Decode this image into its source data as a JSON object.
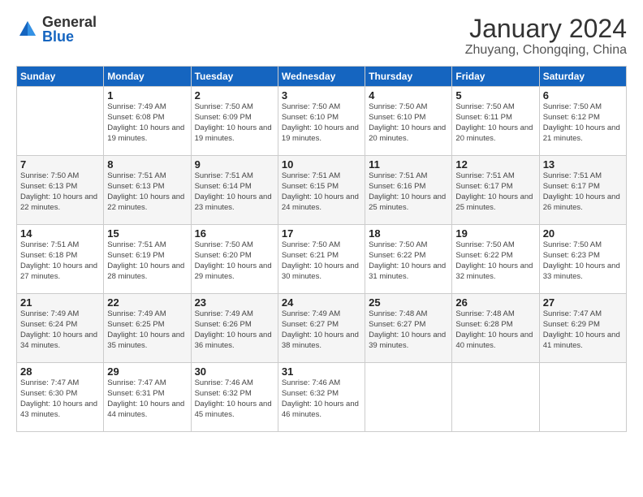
{
  "logo": {
    "general": "General",
    "blue": "Blue"
  },
  "title": "January 2024",
  "subtitle": "Zhuyang, Chongqing, China",
  "days_of_week": [
    "Sunday",
    "Monday",
    "Tuesday",
    "Wednesday",
    "Thursday",
    "Friday",
    "Saturday"
  ],
  "weeks": [
    [
      {
        "date": "",
        "info": ""
      },
      {
        "date": "1",
        "info": "Sunrise: 7:49 AM\nSunset: 6:08 PM\nDaylight: 10 hours\nand 19 minutes."
      },
      {
        "date": "2",
        "info": "Sunrise: 7:50 AM\nSunset: 6:09 PM\nDaylight: 10 hours\nand 19 minutes."
      },
      {
        "date": "3",
        "info": "Sunrise: 7:50 AM\nSunset: 6:10 PM\nDaylight: 10 hours\nand 19 minutes."
      },
      {
        "date": "4",
        "info": "Sunrise: 7:50 AM\nSunset: 6:10 PM\nDaylight: 10 hours\nand 20 minutes."
      },
      {
        "date": "5",
        "info": "Sunrise: 7:50 AM\nSunset: 6:11 PM\nDaylight: 10 hours\nand 20 minutes."
      },
      {
        "date": "6",
        "info": "Sunrise: 7:50 AM\nSunset: 6:12 PM\nDaylight: 10 hours\nand 21 minutes."
      }
    ],
    [
      {
        "date": "7",
        "info": "Sunrise: 7:50 AM\nSunset: 6:13 PM\nDaylight: 10 hours\nand 22 minutes."
      },
      {
        "date": "8",
        "info": "Sunrise: 7:51 AM\nSunset: 6:13 PM\nDaylight: 10 hours\nand 22 minutes."
      },
      {
        "date": "9",
        "info": "Sunrise: 7:51 AM\nSunset: 6:14 PM\nDaylight: 10 hours\nand 23 minutes."
      },
      {
        "date": "10",
        "info": "Sunrise: 7:51 AM\nSunset: 6:15 PM\nDaylight: 10 hours\nand 24 minutes."
      },
      {
        "date": "11",
        "info": "Sunrise: 7:51 AM\nSunset: 6:16 PM\nDaylight: 10 hours\nand 25 minutes."
      },
      {
        "date": "12",
        "info": "Sunrise: 7:51 AM\nSunset: 6:17 PM\nDaylight: 10 hours\nand 25 minutes."
      },
      {
        "date": "13",
        "info": "Sunrise: 7:51 AM\nSunset: 6:17 PM\nDaylight: 10 hours\nand 26 minutes."
      }
    ],
    [
      {
        "date": "14",
        "info": "Sunrise: 7:51 AM\nSunset: 6:18 PM\nDaylight: 10 hours\nand 27 minutes."
      },
      {
        "date": "15",
        "info": "Sunrise: 7:51 AM\nSunset: 6:19 PM\nDaylight: 10 hours\nand 28 minutes."
      },
      {
        "date": "16",
        "info": "Sunrise: 7:50 AM\nSunset: 6:20 PM\nDaylight: 10 hours\nand 29 minutes."
      },
      {
        "date": "17",
        "info": "Sunrise: 7:50 AM\nSunset: 6:21 PM\nDaylight: 10 hours\nand 30 minutes."
      },
      {
        "date": "18",
        "info": "Sunrise: 7:50 AM\nSunset: 6:22 PM\nDaylight: 10 hours\nand 31 minutes."
      },
      {
        "date": "19",
        "info": "Sunrise: 7:50 AM\nSunset: 6:22 PM\nDaylight: 10 hours\nand 32 minutes."
      },
      {
        "date": "20",
        "info": "Sunrise: 7:50 AM\nSunset: 6:23 PM\nDaylight: 10 hours\nand 33 minutes."
      }
    ],
    [
      {
        "date": "21",
        "info": "Sunrise: 7:49 AM\nSunset: 6:24 PM\nDaylight: 10 hours\nand 34 minutes."
      },
      {
        "date": "22",
        "info": "Sunrise: 7:49 AM\nSunset: 6:25 PM\nDaylight: 10 hours\nand 35 minutes."
      },
      {
        "date": "23",
        "info": "Sunrise: 7:49 AM\nSunset: 6:26 PM\nDaylight: 10 hours\nand 36 minutes."
      },
      {
        "date": "24",
        "info": "Sunrise: 7:49 AM\nSunset: 6:27 PM\nDaylight: 10 hours\nand 38 minutes."
      },
      {
        "date": "25",
        "info": "Sunrise: 7:48 AM\nSunset: 6:27 PM\nDaylight: 10 hours\nand 39 minutes."
      },
      {
        "date": "26",
        "info": "Sunrise: 7:48 AM\nSunset: 6:28 PM\nDaylight: 10 hours\nand 40 minutes."
      },
      {
        "date": "27",
        "info": "Sunrise: 7:47 AM\nSunset: 6:29 PM\nDaylight: 10 hours\nand 41 minutes."
      }
    ],
    [
      {
        "date": "28",
        "info": "Sunrise: 7:47 AM\nSunset: 6:30 PM\nDaylight: 10 hours\nand 43 minutes."
      },
      {
        "date": "29",
        "info": "Sunrise: 7:47 AM\nSunset: 6:31 PM\nDaylight: 10 hours\nand 44 minutes."
      },
      {
        "date": "30",
        "info": "Sunrise: 7:46 AM\nSunset: 6:32 PM\nDaylight: 10 hours\nand 45 minutes."
      },
      {
        "date": "31",
        "info": "Sunrise: 7:46 AM\nSunset: 6:32 PM\nDaylight: 10 hours\nand 46 minutes."
      },
      {
        "date": "",
        "info": ""
      },
      {
        "date": "",
        "info": ""
      },
      {
        "date": "",
        "info": ""
      }
    ]
  ]
}
